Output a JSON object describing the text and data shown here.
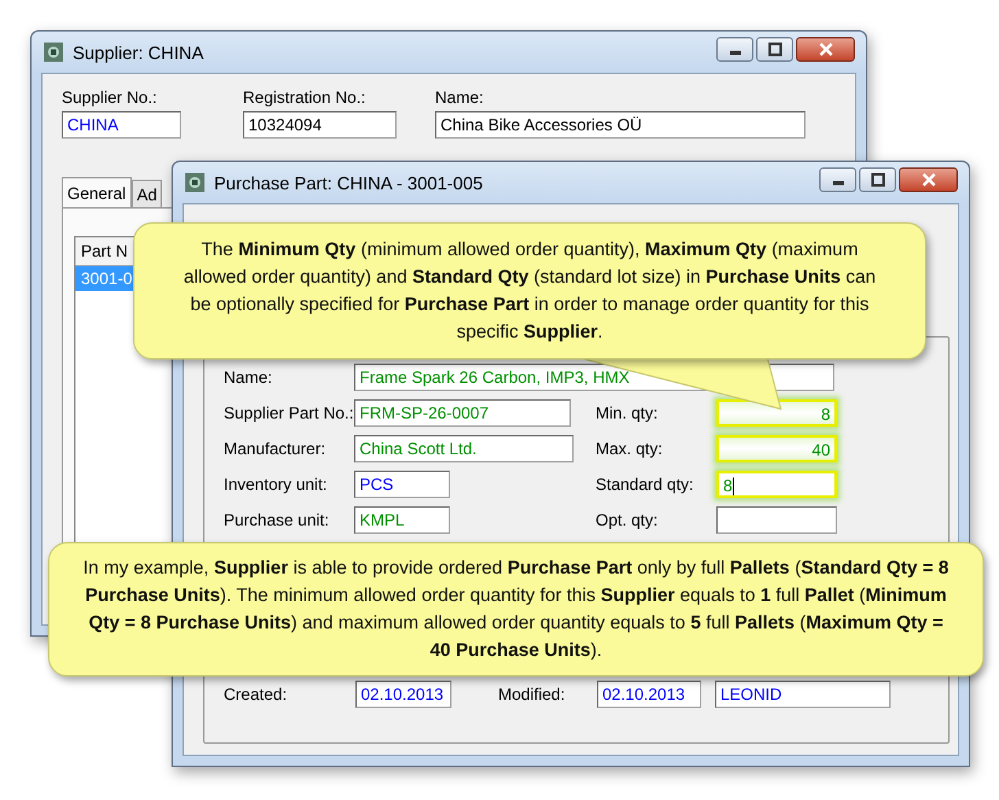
{
  "supplier_window": {
    "title": "Supplier: CHINA",
    "fields": [
      {
        "label": "Supplier No.:",
        "value": "CHINA",
        "color": "#0000ff"
      },
      {
        "label": "Registration No.:",
        "value": "10324094",
        "color": "#000000"
      },
      {
        "label": "Name:",
        "value": "China Bike Accessories OÜ",
        "color": "#000000"
      }
    ],
    "tabs": [
      {
        "label": "General",
        "selected": true
      },
      {
        "label": "Ad",
        "selected": false
      }
    ],
    "parts_list": {
      "columns": [
        "Part N"
      ],
      "rows": [
        {
          "part_no": "3001-0",
          "selected": true
        }
      ]
    }
  },
  "purchase_part_window": {
    "title": "Purchase Part: CHINA - 3001-005",
    "left_fields": [
      {
        "label": "Name:",
        "value": "Frame Spark 26 Carbon, IMP3, HMX",
        "color": "#009000"
      },
      {
        "label": "Supplier Part No.:",
        "value": "FRM-SP-26-0007",
        "color": "#009000"
      },
      {
        "label": "Manufacturer:",
        "value": "China Scott Ltd.",
        "color": "#009000"
      },
      {
        "label": "Inventory unit:",
        "value": "PCS",
        "color": "#0000ff"
      },
      {
        "label": "Purchase unit:",
        "value": "KMPL",
        "color": "#009000"
      }
    ],
    "right_fields": [
      {
        "label": "Min. qty:",
        "value": "8",
        "highlighted": true,
        "focused": false
      },
      {
        "label": "Max. qty:",
        "value": "40",
        "highlighted": true,
        "focused": false
      },
      {
        "label": "Standard qty:",
        "value": "8",
        "highlighted": true,
        "focused": true
      },
      {
        "label": "Opt. qty:",
        "highlighted": false,
        "focused": false
      }
    ],
    "footer": {
      "created_label": "Created:",
      "created": "02.10.2013",
      "modified_label": "Modified:",
      "modified": "02.10.2013",
      "modified_by": "LEONID"
    }
  },
  "callouts": [
    {
      "text": "The **Minimum Qty** (minimum allowed order quantity), **Maximum Qty** (maximum allowed order quantity) and **Standard Qty** (standard lot size) in **Purchase Units** can be optionally specified for **Purchase Part** in order to manage order quantity for this specific **Supplier**.",
      "tail": true
    },
    {
      "text": "In my example, **Supplier** is able to provide ordered **Purchase Part** only by full **Pallets** (**Standard Qty = 8 Purchase Units**). The minimum allowed order quantity for this **Supplier** equals to **1** full **Pallet** (**Minimum Qty = 8 Purchase Units**) and maximum allowed order quantity equals to **5** full **Pallets** (**Maximum Qty = 40 Purchase Units**).",
      "tail": false
    }
  ]
}
